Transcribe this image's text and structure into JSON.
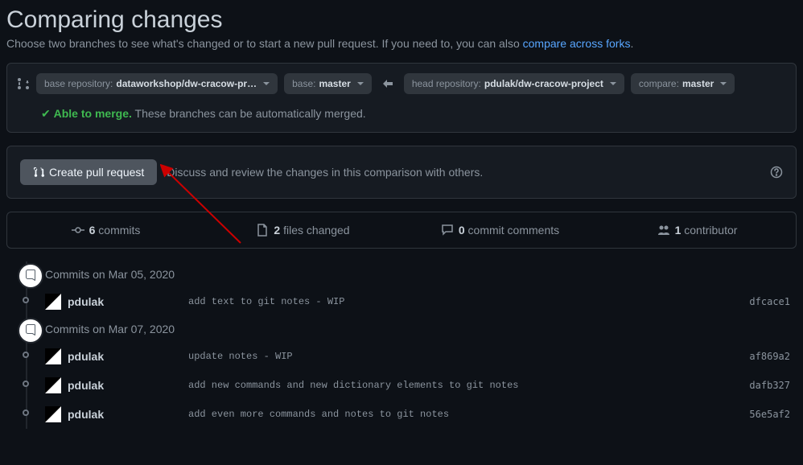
{
  "header": {
    "title": "Comparing changes",
    "subtext_prefix": "Choose two branches to see what's changed or to start a new pull request. If you need to, you can also ",
    "link_text": "compare across forks",
    "subtext_suffix": "."
  },
  "range": {
    "base_repo_label": "base repository: ",
    "base_repo_value": "dataworkshop/dw-cracow-pr…",
    "base_label": "base: ",
    "base_value": "master",
    "head_repo_label": "head repository: ",
    "head_repo_value": "pdulak/dw-cracow-project",
    "compare_label": "compare: ",
    "compare_value": "master"
  },
  "merge": {
    "status": "Able to merge.",
    "detail": " These branches can be automatically merged."
  },
  "pr": {
    "button": "Create pull request",
    "desc": "Discuss and review the changes in this comparison with others."
  },
  "stats": {
    "commits_count": "6",
    "commits_label": " commits",
    "files_count": "2",
    "files_label": " files changed",
    "comments_count": "0",
    "comments_label": " commit comments",
    "contributors_count": "1",
    "contributors_label": " contributor"
  },
  "groups": [
    {
      "date": "Commits on Mar 05, 2020",
      "commits": [
        {
          "author": "pdulak",
          "msg": "add text to git notes - WIP",
          "sha": "dfcace1"
        }
      ]
    },
    {
      "date": "Commits on Mar 07, 2020",
      "commits": [
        {
          "author": "pdulak",
          "msg": "update notes - WIP",
          "sha": "af869a2"
        },
        {
          "author": "pdulak",
          "msg": "add new commands and new dictionary elements to git notes",
          "sha": "dafb327"
        },
        {
          "author": "pdulak",
          "msg": "add even more commands and notes to git notes",
          "sha": "56e5af2"
        }
      ]
    }
  ]
}
